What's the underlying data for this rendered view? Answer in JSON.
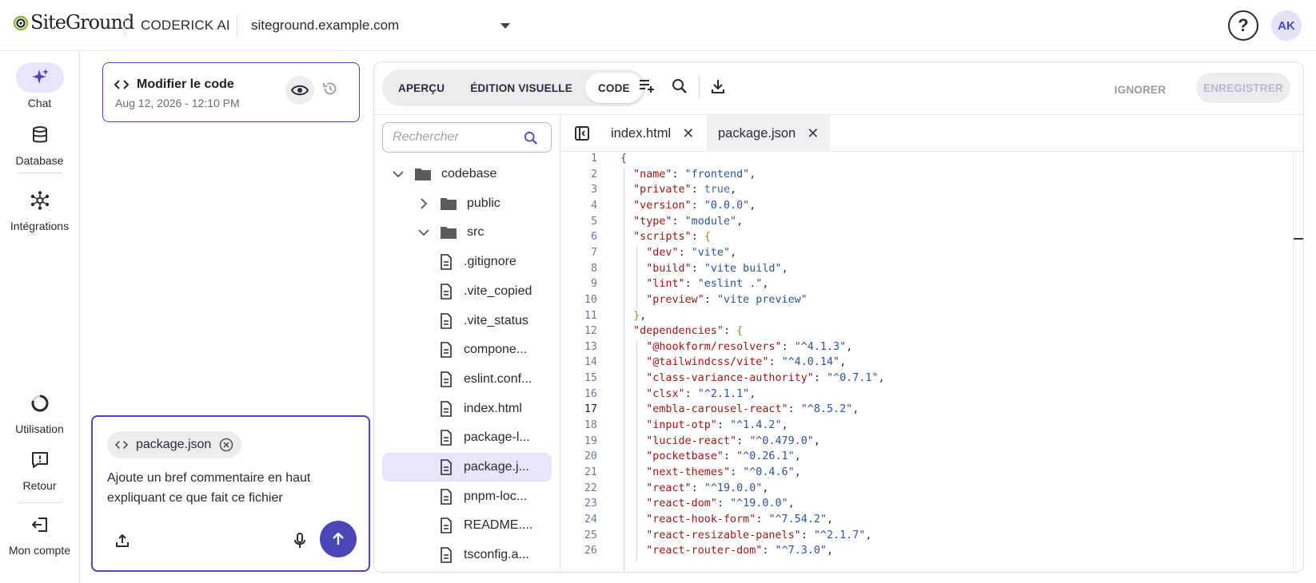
{
  "header": {
    "brand": "SiteGround",
    "app_name": "CODERICK AI",
    "site": "siteground.example.com",
    "help_symbol": "?",
    "avatar_initials": "AK"
  },
  "nav": {
    "items": [
      {
        "label": "Chat",
        "icon": "sparkle-icon",
        "active": true
      },
      {
        "label": "Database",
        "icon": "database-icon"
      },
      {
        "label": "Intégrations",
        "icon": "integrations-icon"
      },
      {
        "label": "Utilisation",
        "icon": "usage-ring-icon"
      },
      {
        "label": "Retour",
        "icon": "feedback-icon"
      },
      {
        "label": "Mon compte",
        "icon": "logout-icon"
      }
    ]
  },
  "history": {
    "title": "Modifier le code",
    "date": "Aug 12, 2026 - 12:10 PM"
  },
  "composer": {
    "attachment": "package.json",
    "text": "Ajoute un bref commentaire en haut expliquant ce que fait ce fichier"
  },
  "toolbar": {
    "tabs": [
      "APERÇU",
      "ÉDITION VISUELLE",
      "CODE"
    ],
    "active_tab": "CODE",
    "ignore_label": "IGNORER",
    "save_label": "ENREGISTRER"
  },
  "tree": {
    "search_placeholder": "Rechercher",
    "items": [
      {
        "label": "codebase",
        "type": "folder",
        "expanded": true
      },
      {
        "label": "public",
        "type": "folder",
        "expanded": false
      },
      {
        "label": "src",
        "type": "folder",
        "expanded": true
      },
      {
        "label": ".gitignore",
        "type": "file"
      },
      {
        "label": ".vite_copied",
        "type": "file"
      },
      {
        "label": ".vite_status",
        "type": "file"
      },
      {
        "label": "compone...",
        "type": "file"
      },
      {
        "label": "eslint.conf...",
        "type": "file"
      },
      {
        "label": "index.html",
        "type": "file"
      },
      {
        "label": "package-l...",
        "type": "file"
      },
      {
        "label": "package.j...",
        "type": "file",
        "selected": true
      },
      {
        "label": "pnpm-loc...",
        "type": "file"
      },
      {
        "label": "README....",
        "type": "file"
      },
      {
        "label": "tsconfig.a...",
        "type": "file"
      }
    ]
  },
  "file_tabs": [
    {
      "label": "index.html",
      "active": false
    },
    {
      "label": "package.json",
      "active": true
    }
  ],
  "code": {
    "current_line": 17,
    "lines": [
      [
        [
          "br",
          "{"
        ]
      ],
      [
        [
          "p",
          "  "
        ],
        [
          "k",
          "\"name\""
        ],
        [
          "p",
          ": "
        ],
        [
          "s",
          "\"frontend\""
        ],
        [
          "p",
          ","
        ]
      ],
      [
        [
          "p",
          "  "
        ],
        [
          "k",
          "\"private\""
        ],
        [
          "p",
          ": "
        ],
        [
          "b",
          "true"
        ],
        [
          "p",
          ","
        ]
      ],
      [
        [
          "p",
          "  "
        ],
        [
          "k",
          "\"version\""
        ],
        [
          "p",
          ": "
        ],
        [
          "s",
          "\"0.0.0\""
        ],
        [
          "p",
          ","
        ]
      ],
      [
        [
          "p",
          "  "
        ],
        [
          "k",
          "\"type\""
        ],
        [
          "p",
          ": "
        ],
        [
          "s",
          "\"module\""
        ],
        [
          "p",
          ","
        ]
      ],
      [
        [
          "p",
          "  "
        ],
        [
          "k",
          "\"scripts\""
        ],
        [
          "p",
          ": "
        ],
        [
          "br2",
          "{"
        ]
      ],
      [
        [
          "p",
          "    "
        ],
        [
          "k",
          "\"dev\""
        ],
        [
          "p",
          ": "
        ],
        [
          "s",
          "\"vite\""
        ],
        [
          "p",
          ","
        ]
      ],
      [
        [
          "p",
          "    "
        ],
        [
          "k",
          "\"build\""
        ],
        [
          "p",
          ": "
        ],
        [
          "s",
          "\"vite build\""
        ],
        [
          "p",
          ","
        ]
      ],
      [
        [
          "p",
          "    "
        ],
        [
          "k",
          "\"lint\""
        ],
        [
          "p",
          ": "
        ],
        [
          "s",
          "\"eslint .\""
        ],
        [
          "p",
          ","
        ]
      ],
      [
        [
          "p",
          "    "
        ],
        [
          "k",
          "\"preview\""
        ],
        [
          "p",
          ": "
        ],
        [
          "s",
          "\"vite preview\""
        ]
      ],
      [
        [
          "p",
          "  "
        ],
        [
          "br2",
          "}"
        ],
        [
          "p",
          ","
        ]
      ],
      [
        [
          "p",
          "  "
        ],
        [
          "k",
          "\"dependencies\""
        ],
        [
          "p",
          ": "
        ],
        [
          "br2",
          "{"
        ]
      ],
      [
        [
          "p",
          "    "
        ],
        [
          "k",
          "\"@hookform/resolvers\""
        ],
        [
          "p",
          ": "
        ],
        [
          "s",
          "\"^4.1.3\""
        ],
        [
          "p",
          ","
        ]
      ],
      [
        [
          "p",
          "    "
        ],
        [
          "k",
          "\"@tailwindcss/vite\""
        ],
        [
          "p",
          ": "
        ],
        [
          "s",
          "\"^4.0.14\""
        ],
        [
          "p",
          ","
        ]
      ],
      [
        [
          "p",
          "    "
        ],
        [
          "k",
          "\"class-variance-authority\""
        ],
        [
          "p",
          ": "
        ],
        [
          "s",
          "\"^0.7.1\""
        ],
        [
          "p",
          ","
        ]
      ],
      [
        [
          "p",
          "    "
        ],
        [
          "k",
          "\"clsx\""
        ],
        [
          "p",
          ": "
        ],
        [
          "s",
          "\"^2.1.1\""
        ],
        [
          "p",
          ","
        ]
      ],
      [
        [
          "p",
          "    "
        ],
        [
          "k",
          "\"embla-carousel-react\""
        ],
        [
          "p",
          ": "
        ],
        [
          "s",
          "\"^8.5.2\""
        ],
        [
          "p",
          ","
        ]
      ],
      [
        [
          "p",
          "    "
        ],
        [
          "k",
          "\"input-otp\""
        ],
        [
          "p",
          ": "
        ],
        [
          "s",
          "\"^1.4.2\""
        ],
        [
          "p",
          ","
        ]
      ],
      [
        [
          "p",
          "    "
        ],
        [
          "k",
          "\"lucide-react\""
        ],
        [
          "p",
          ": "
        ],
        [
          "s",
          "\"^0.479.0\""
        ],
        [
          "p",
          ","
        ]
      ],
      [
        [
          "p",
          "    "
        ],
        [
          "k",
          "\"pocketbase\""
        ],
        [
          "p",
          ": "
        ],
        [
          "s",
          "\"^0.26.1\""
        ],
        [
          "p",
          ","
        ]
      ],
      [
        [
          "p",
          "    "
        ],
        [
          "k",
          "\"next-themes\""
        ],
        [
          "p",
          ": "
        ],
        [
          "s",
          "\"^0.4.6\""
        ],
        [
          "p",
          ","
        ]
      ],
      [
        [
          "p",
          "    "
        ],
        [
          "k",
          "\"react\""
        ],
        [
          "p",
          ": "
        ],
        [
          "s",
          "\"^19.0.0\""
        ],
        [
          "p",
          ","
        ]
      ],
      [
        [
          "p",
          "    "
        ],
        [
          "k",
          "\"react-dom\""
        ],
        [
          "p",
          ": "
        ],
        [
          "s",
          "\"^19.0.0\""
        ],
        [
          "p",
          ","
        ]
      ],
      [
        [
          "p",
          "    "
        ],
        [
          "k",
          "\"react-hook-form\""
        ],
        [
          "p",
          ": "
        ],
        [
          "s",
          "\"^7.54.2\""
        ],
        [
          "p",
          ","
        ]
      ],
      [
        [
          "p",
          "    "
        ],
        [
          "k",
          "\"react-resizable-panels\""
        ],
        [
          "p",
          ": "
        ],
        [
          "s",
          "\"^2.1.7\""
        ],
        [
          "p",
          ","
        ]
      ],
      [
        [
          "p",
          "    "
        ],
        [
          "k",
          "\"react-router-dom\""
        ],
        [
          "p",
          ": "
        ],
        [
          "s",
          "\"^7.3.0\""
        ],
        [
          "p",
          ","
        ]
      ]
    ]
  },
  "colors": {
    "accent": "#4b47b9",
    "key": "#a31515",
    "string": "#2a52a8"
  }
}
